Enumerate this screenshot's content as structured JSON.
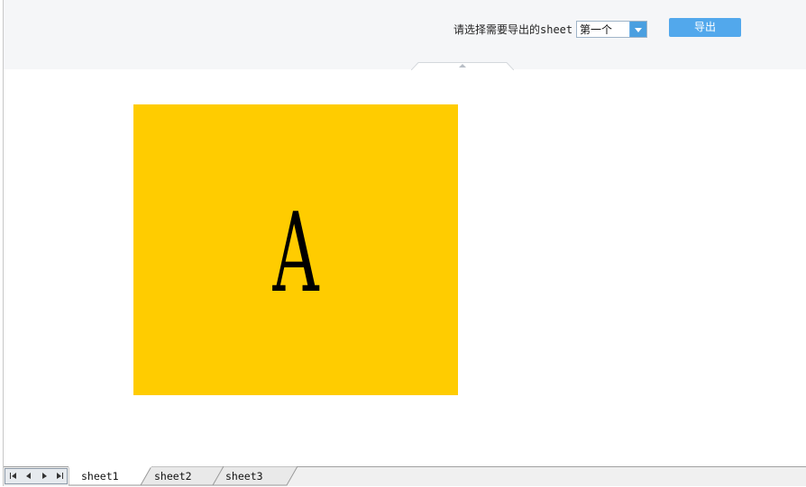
{
  "toolbar": {
    "label": "请选择需要导出的sheet",
    "sheet_select": {
      "value": "第一个"
    },
    "export_label": "导出"
  },
  "content": {
    "shape_text": "A",
    "shape_color": "#ffcc00"
  },
  "tabbar": {
    "tabs": [
      {
        "label": "sheet1",
        "active": true
      },
      {
        "label": "sheet2",
        "active": false
      },
      {
        "label": "sheet3",
        "active": false
      }
    ]
  },
  "colors": {
    "toolbar_bg": "#f5f6f8",
    "accent": "#52a8ec"
  }
}
